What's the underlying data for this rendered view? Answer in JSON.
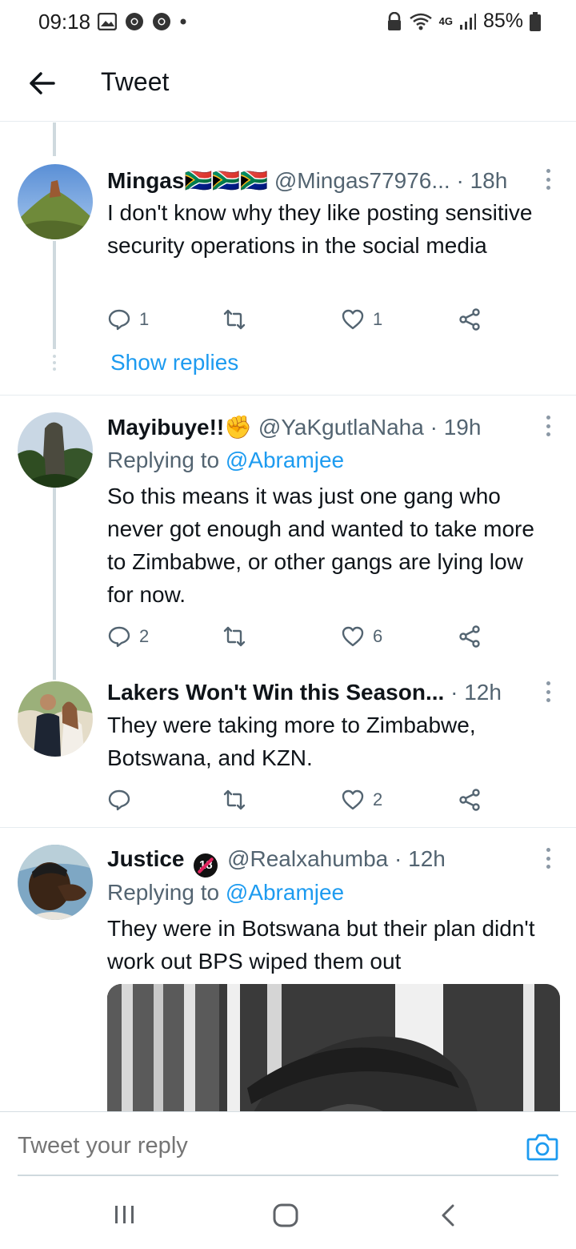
{
  "status_bar": {
    "time": "09:18",
    "network": "4G",
    "battery": "85%"
  },
  "header": {
    "title": "Tweet"
  },
  "tweets": [
    {
      "name": "Mingas🇿🇦🇿🇦🇿🇦",
      "handle": "@Mingas77976...",
      "time": "· 18h",
      "text": "I don't know why they like posting sensitive security operations in the social media",
      "replies": "1",
      "retweets": "",
      "likes": "1"
    },
    {
      "name": "Mayibuye!!✊",
      "handle": "@YaKgutlaNaha",
      "time": "· 19h",
      "replying_label": "Replying to",
      "replying_to": "@Abramjee",
      "text": "So this means it was just one gang who never got enough and wanted to take more to Zimbabwe, or other gangs are lying low for now.",
      "replies": "2",
      "retweets": "",
      "likes": "6"
    },
    {
      "name": "Lakers Won't Win this Season...",
      "handle": "",
      "time": "· 12h",
      "text": "They were taking more to Zimbabwe, Botswana, and KZN.",
      "replies": "",
      "retweets": "",
      "likes": "2"
    },
    {
      "name": "Justice",
      "badge": "18",
      "handle": "@Realxahumba",
      "time": "· 12h",
      "replying_label": "Replying to",
      "replying_to": "@Abramjee",
      "text": "They were in Botswana but their plan didn't work out BPS wiped them out"
    }
  ],
  "show_replies": "Show replies",
  "reply_bar": {
    "placeholder": "Tweet your reply"
  },
  "colors": {
    "accent": "#1d9bf0",
    "secondary_text": "#536471",
    "thread_line": "#cfd9de"
  }
}
